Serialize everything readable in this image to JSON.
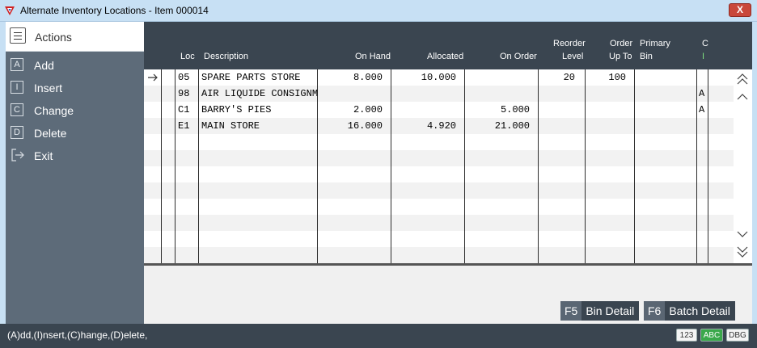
{
  "window": {
    "title": "Alternate Inventory Locations - Item 000014",
    "close_symbol": "X"
  },
  "actions": {
    "title": "Actions",
    "items": [
      {
        "key": "A",
        "label": "Add"
      },
      {
        "key": "I",
        "label": "Insert"
      },
      {
        "key": "C",
        "label": "Change"
      },
      {
        "key": "D",
        "label": "Delete"
      },
      {
        "key": "",
        "label": "Exit"
      }
    ]
  },
  "grid": {
    "headers": {
      "loc": "Loc",
      "description": "Description",
      "on_hand": "On Hand",
      "allocated": "Allocated",
      "on_order": "On Order",
      "reorder_1": "Reorder",
      "reorder_2": "Level",
      "order_up_to_1": "Order",
      "order_up_to_2": "Up To",
      "primary_bin_1": "Primary",
      "primary_bin_2": "Bin",
      "ci_1": "C",
      "ci_2": "I"
    },
    "rows": [
      {
        "loc": "05",
        "description": "SPARE PARTS STORE",
        "on_hand": "8.000",
        "allocated": "10.000",
        "on_order": "",
        "reorder": "20",
        "order_up_to": "100",
        "primary_bin": "",
        "ci": ""
      },
      {
        "loc": "98",
        "description": "AIR LIQUIDE CONSIGNM",
        "on_hand": "",
        "allocated": "",
        "on_order": "",
        "reorder": "",
        "order_up_to": "",
        "primary_bin": "",
        "ci": "A"
      },
      {
        "loc": "C1",
        "description": "BARRY'S PIES",
        "on_hand": "2.000",
        "allocated": "",
        "on_order": "5.000",
        "reorder": "",
        "order_up_to": "",
        "primary_bin": "",
        "ci": "A"
      },
      {
        "loc": "E1",
        "description": "MAIN STORE",
        "on_hand": "16.000",
        "allocated": "4.920",
        "on_order": "21.000",
        "reorder": "",
        "order_up_to": "",
        "primary_bin": "",
        "ci": ""
      }
    ]
  },
  "buttons": {
    "bin_detail": {
      "key": "F5",
      "label": "Bin Detail"
    },
    "batch_detail": {
      "key": "F6",
      "label": "Batch Detail"
    }
  },
  "status": {
    "text": "(A)dd,(I)nsert,(C)hange,(D)elete,",
    "badges": [
      "123",
      "ABC",
      "DBG"
    ],
    "abc_color": "#3aa84a"
  }
}
